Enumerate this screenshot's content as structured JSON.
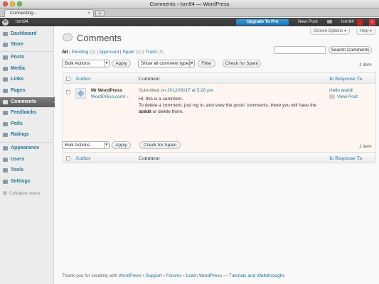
{
  "window": {
    "title": "Comments ‹ lsrn94 — WordPress"
  },
  "tab": {
    "label": "Connecting...",
    "close": "×",
    "new": "+"
  },
  "adminbar": {
    "wp_logo": "W",
    "site_name": "lsrn94",
    "upgrade": "Upgrade To Pro",
    "new_post": "New Post",
    "user": "lsrn94"
  },
  "sidebar": {
    "items": [
      {
        "label": "Dashboard",
        "icon": "dashboard-icon"
      },
      {
        "label": "Store",
        "icon": "store-icon"
      },
      {
        "label": "Posts",
        "icon": "posts-icon"
      },
      {
        "label": "Media",
        "icon": "media-icon"
      },
      {
        "label": "Links",
        "icon": "links-icon"
      },
      {
        "label": "Pages",
        "icon": "pages-icon"
      },
      {
        "label": "Comments",
        "icon": "comments-icon",
        "current": true
      },
      {
        "label": "Feedbacks",
        "icon": "feedbacks-icon"
      },
      {
        "label": "Polls",
        "icon": "polls-icon"
      },
      {
        "label": "Ratings",
        "icon": "ratings-icon"
      },
      {
        "label": "Appearance",
        "icon": "appearance-icon"
      },
      {
        "label": "Users",
        "icon": "users-icon"
      },
      {
        "label": "Tools",
        "icon": "tools-icon"
      },
      {
        "label": "Settings",
        "icon": "settings-icon"
      }
    ],
    "collapse": "Collapse menu"
  },
  "header": {
    "screen_options": "Screen Options ▾",
    "help": "Help ▾",
    "title": "Comments"
  },
  "filters": {
    "all": "All",
    "pending": "Pending",
    "pending_count": "(0)",
    "approved": "Approved",
    "spam": "Spam",
    "spam_count": "(0)",
    "trash": "Trash",
    "trash_count": "(0)",
    "sep": "|"
  },
  "search": {
    "button": "Search Comments",
    "value": ""
  },
  "bulk": {
    "select": "Bulk Actions",
    "apply": "Apply",
    "type_select": "Show all comment types",
    "filter": "Filter",
    "check_spam": "Check for Spam"
  },
  "item_count": "1 item",
  "table": {
    "columns": {
      "author": "Author",
      "comment": "Comment",
      "response": "In Response To"
    },
    "row": {
      "author_name": "Mr WordPress",
      "author_url": "WordPress.com/",
      "author_sep": "x",
      "submitted_prefix": "Submitted on",
      "submitted_date": "2012/06/17 at 5:28 pm",
      "lines": [
        "Hi, this is a comment.",
        "To delete a comment, just log in, and view the posts' comments, there you will have the option",
        "to edit or delete them."
      ],
      "response_title": "Hello world!",
      "view_post": "View Post"
    }
  },
  "footer": {
    "text_prefix": "Thank you for creating with",
    "wordpress": "WordPress",
    "support": "Support",
    "forums": "Forums",
    "learn": "Learn WordPress — Tutorials and Walkthroughs",
    "bullet": "•"
  },
  "colors": {
    "link": "#21759b",
    "adminbar": "#464646",
    "upgrade": "#2a86c6",
    "current_menu": "#6d6d6d",
    "row_bg": "#fef7f1"
  }
}
